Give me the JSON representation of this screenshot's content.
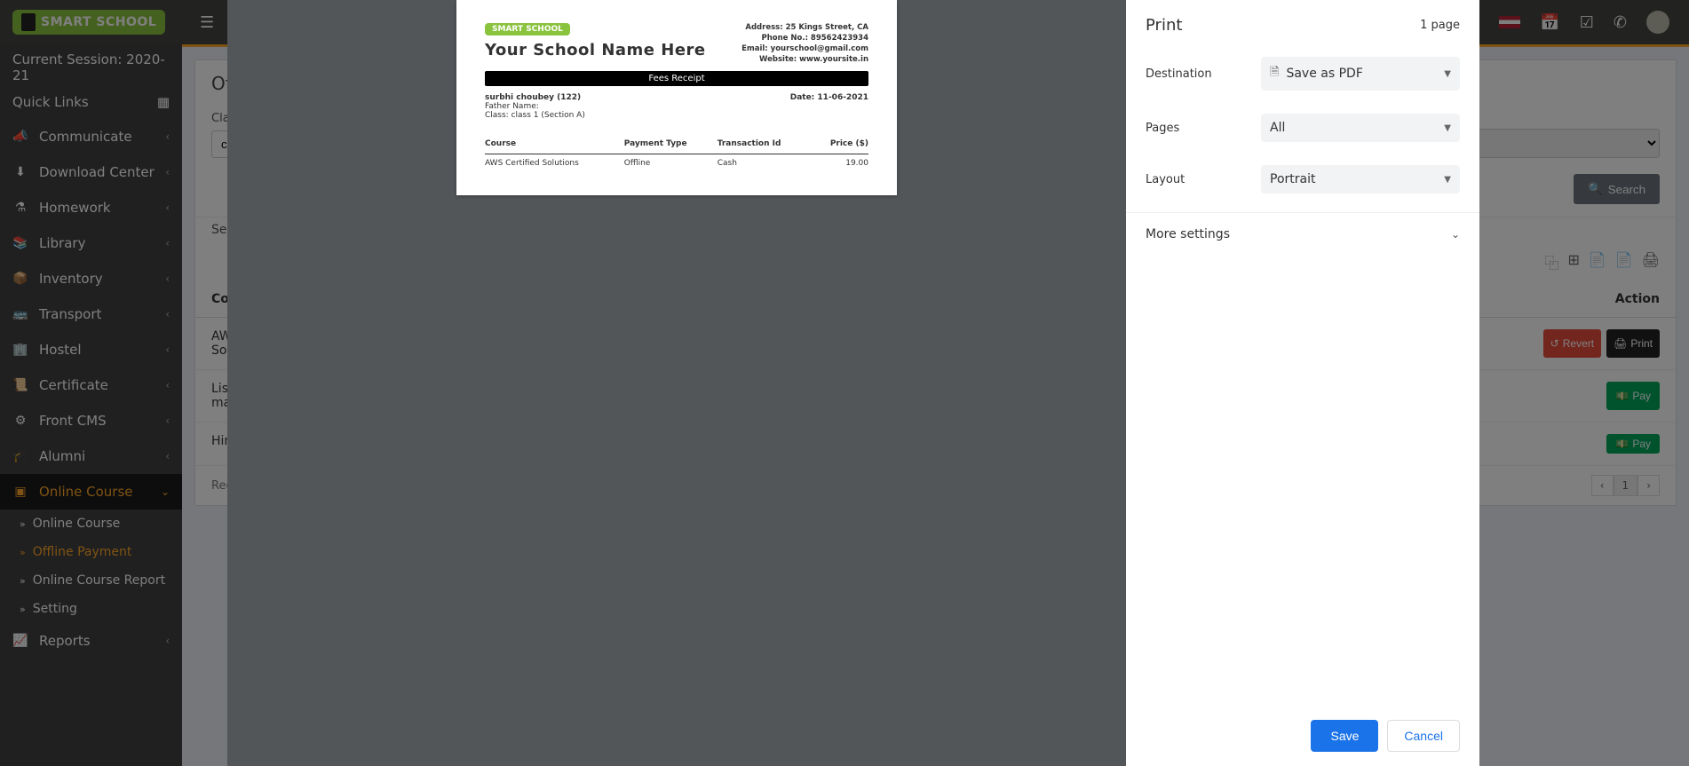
{
  "topbar": {
    "brand": "SMART SCHOOL",
    "session": "Current Session: 2020-21",
    "quicklinks": "Quick Links"
  },
  "sidebar": {
    "items": [
      {
        "icon": "📣",
        "label": "Communicate"
      },
      {
        "icon": "⬇",
        "label": "Download Center"
      },
      {
        "icon": "⚗",
        "label": "Homework"
      },
      {
        "icon": "📚",
        "label": "Library"
      },
      {
        "icon": "📦",
        "label": "Inventory"
      },
      {
        "icon": "🚌",
        "label": "Transport"
      },
      {
        "icon": "🏢",
        "label": "Hostel"
      },
      {
        "icon": "📜",
        "label": "Certificate"
      },
      {
        "icon": "⚙",
        "label": "Front CMS"
      },
      {
        "icon": "🎓",
        "label": "Alumni"
      },
      {
        "icon": "▣",
        "label": "Online Course"
      },
      {
        "icon": "📈",
        "label": "Reports"
      }
    ],
    "sub": [
      {
        "label": "Online Course"
      },
      {
        "label": "Offline Payment"
      },
      {
        "label": "Online Course Report"
      },
      {
        "label": "Setting"
      }
    ]
  },
  "main": {
    "title": "Offl",
    "class_label": "Class",
    "class_value_prefix": "cl",
    "search_btn": "Search",
    "search_label": "Searc",
    "col_course": "Cour",
    "col_action": "Action",
    "rows": [
      {
        "course": "AWS\nSolu"
      },
      {
        "course": "Lists\nmath"
      },
      {
        "course": "Hind"
      }
    ],
    "records": "Record",
    "revert": "Revert",
    "print": "Print",
    "pay": "Pay"
  },
  "print_dialog": {
    "title": "Print",
    "pages": "1 page",
    "dest_label": "Destination",
    "dest_value": "Save as PDF",
    "pages_label": "Pages",
    "pages_value": "All",
    "layout_label": "Layout",
    "layout_value": "Portrait",
    "more": "More settings",
    "save": "Save",
    "cancel": "Cancel"
  },
  "receipt": {
    "logo": "SMART SCHOOL",
    "school": "Your School Name Here",
    "addr1": "Address: 25 Kings Street, CA",
    "addr2": "Phone No.: 89562423934",
    "addr3": "Email: yourschool@gmail.com",
    "addr4": "Website: www.yoursite.in",
    "fees_bar": "Fees Receipt",
    "student": "surbhi choubey (122)",
    "father": "Father Name:",
    "class": "Class: class 1 (Section A)",
    "date": "Date: 11-06-2021",
    "th1": "Course",
    "th2": "Payment Type",
    "th3": "Transaction Id",
    "th4": "Price ($)",
    "row": {
      "course": "AWS Certified Solutions",
      "ptype": "Offline",
      "txn": "Cash",
      "price": "19.00"
    }
  }
}
